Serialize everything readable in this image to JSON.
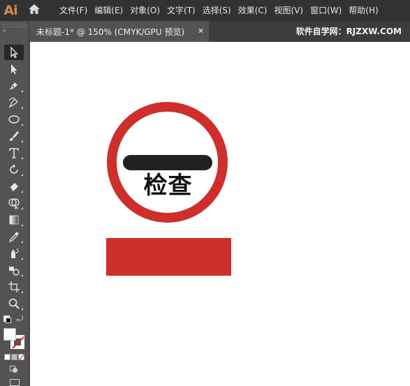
{
  "app": {
    "logo_text": "Ai",
    "logo_color": "#d58a47",
    "home_icon": "home-icon"
  },
  "menu": {
    "items": [
      "文件(F)",
      "编辑(E)",
      "对象(O)",
      "文字(T)",
      "选择(S)",
      "效果(C)",
      "视图(V)",
      "窗口(W)",
      "帮助(H)"
    ]
  },
  "tab": {
    "title": "未标题-1* @ 150% (CMYK/GPU 预览)",
    "close": "×"
  },
  "watermark": "软件自学网：RJZXW.COM",
  "tools": [
    "selection-tool",
    "direct-selection-tool",
    "pen-tool",
    "curvature-tool",
    "ellipse-tool",
    "paintbrush-tool",
    "type-tool",
    "rotate-tool",
    "eraser-tool",
    "shape-builder-tool",
    "gradient-tool",
    "eyedropper-tool",
    "symbol-sprayer-tool",
    "live-paint-tool",
    "artboard-tool",
    "zoom-tool"
  ],
  "canvas": {
    "sign_text": "检查",
    "accent_red": "#cf2f2b",
    "bar_color": "#222222",
    "background": "#ffffff"
  }
}
